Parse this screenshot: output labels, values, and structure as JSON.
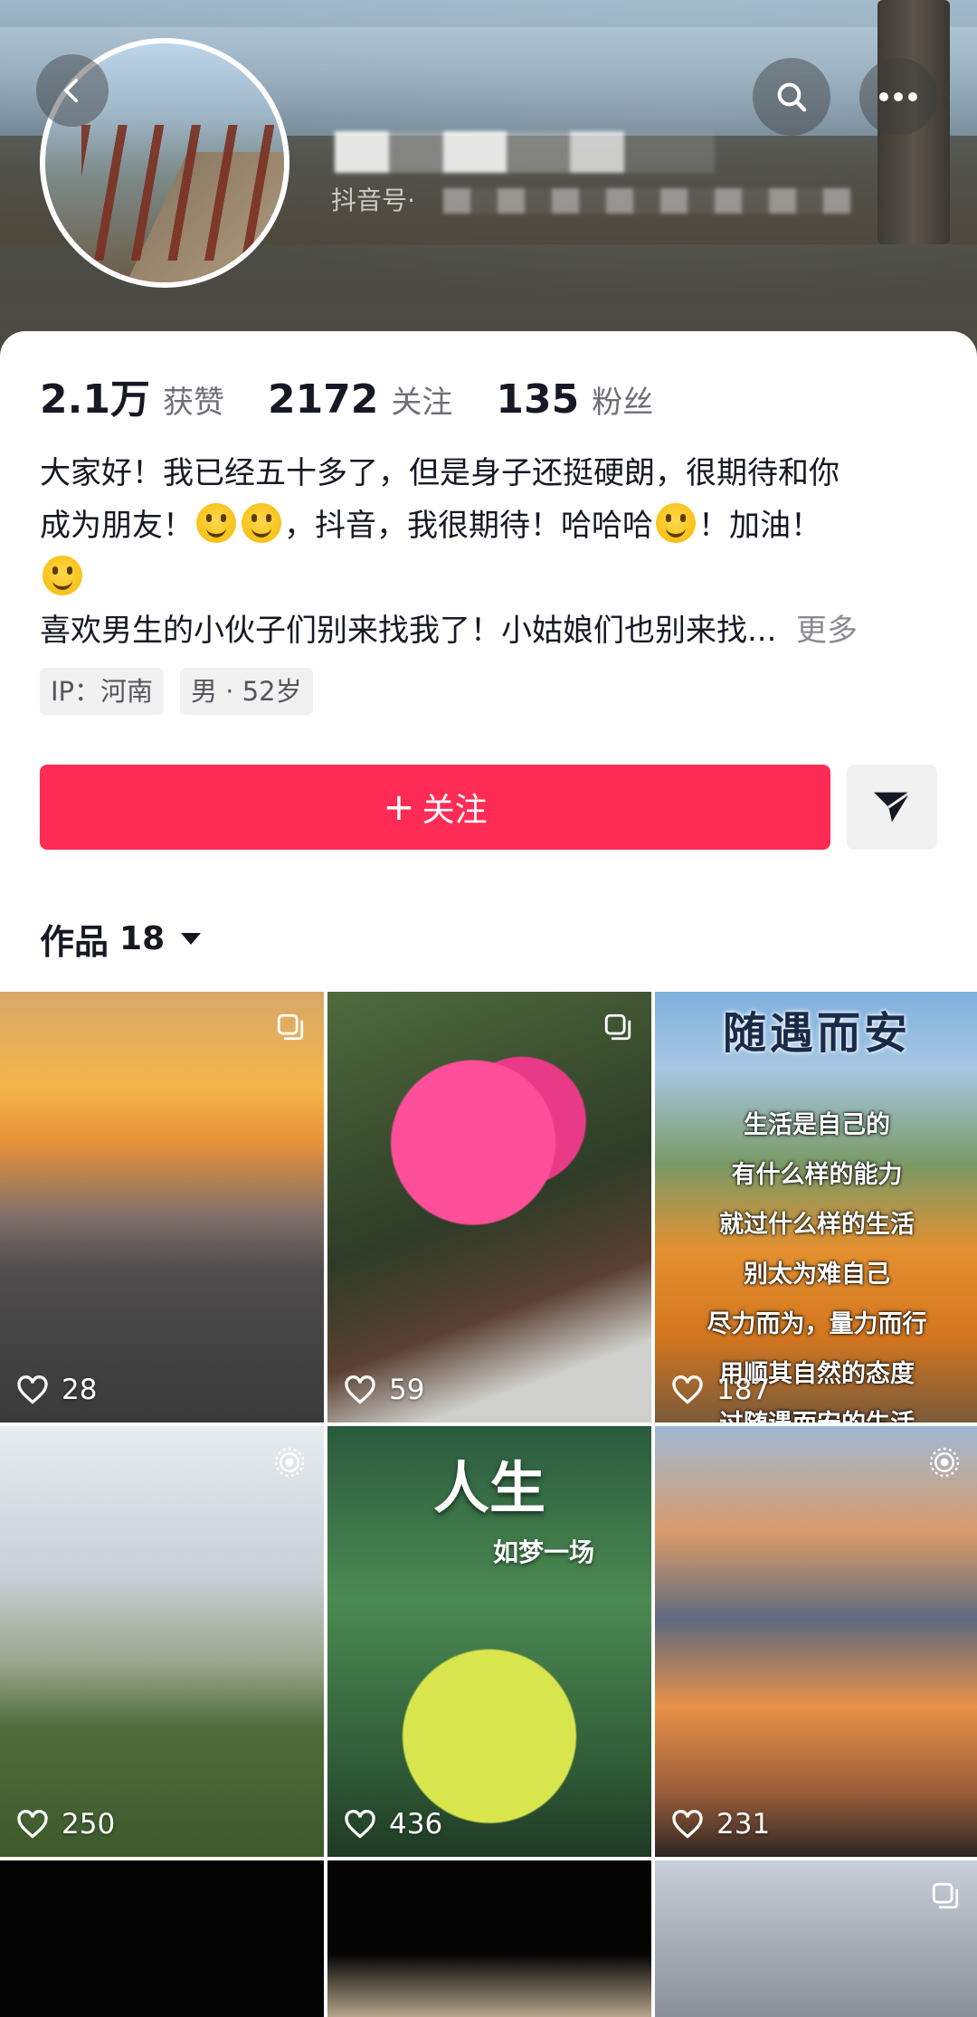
{
  "header": {
    "douyin_id_label": "抖音号·"
  },
  "stats": [
    {
      "value": "2.1万",
      "label": "获赞"
    },
    {
      "value": "2172",
      "label": "关注"
    },
    {
      "value": "135",
      "label": "粉丝"
    }
  ],
  "bio": {
    "line1": "大家好！我已经五十多了，但是身子还挺硬朗，很期待和你",
    "line2a": "成为朋友！",
    "line2b": "，抖音，我很期待！哈哈哈",
    "line2c": "！加油！",
    "line4": "喜欢男生的小伙子们别来找我了！小姑娘们也别来找...",
    "more": "更多"
  },
  "tags": [
    "IP：河南",
    "男 · 52岁"
  ],
  "actions": {
    "follow_label": "关注",
    "follow_plus": "+",
    "accent_color": "#fe2c55"
  },
  "works": {
    "label": "作品",
    "count": "18"
  },
  "tiles": [
    {
      "likes": "28",
      "badge": "multi-image-icon"
    },
    {
      "likes": "59",
      "badge": "multi-image-icon"
    },
    {
      "likes": "187",
      "head": "随遇而安",
      "lines": [
        "生活是自己的",
        "有什么样的能力",
        "就过什么样的生活",
        "别太为难自己",
        "尽力而为，量力而行",
        "用顺其自然的态度",
        "过随遇而安的生活"
      ]
    },
    {
      "likes": "250",
      "badge": "live-photo-icon"
    },
    {
      "likes": "436",
      "head": "人生",
      "sub": "如梦一场"
    },
    {
      "likes": "231",
      "badge": "live-photo-icon"
    },
    {
      "likes": ""
    },
    {
      "likes": ""
    },
    {
      "likes": "",
      "badge": "multi-image-icon"
    }
  ]
}
